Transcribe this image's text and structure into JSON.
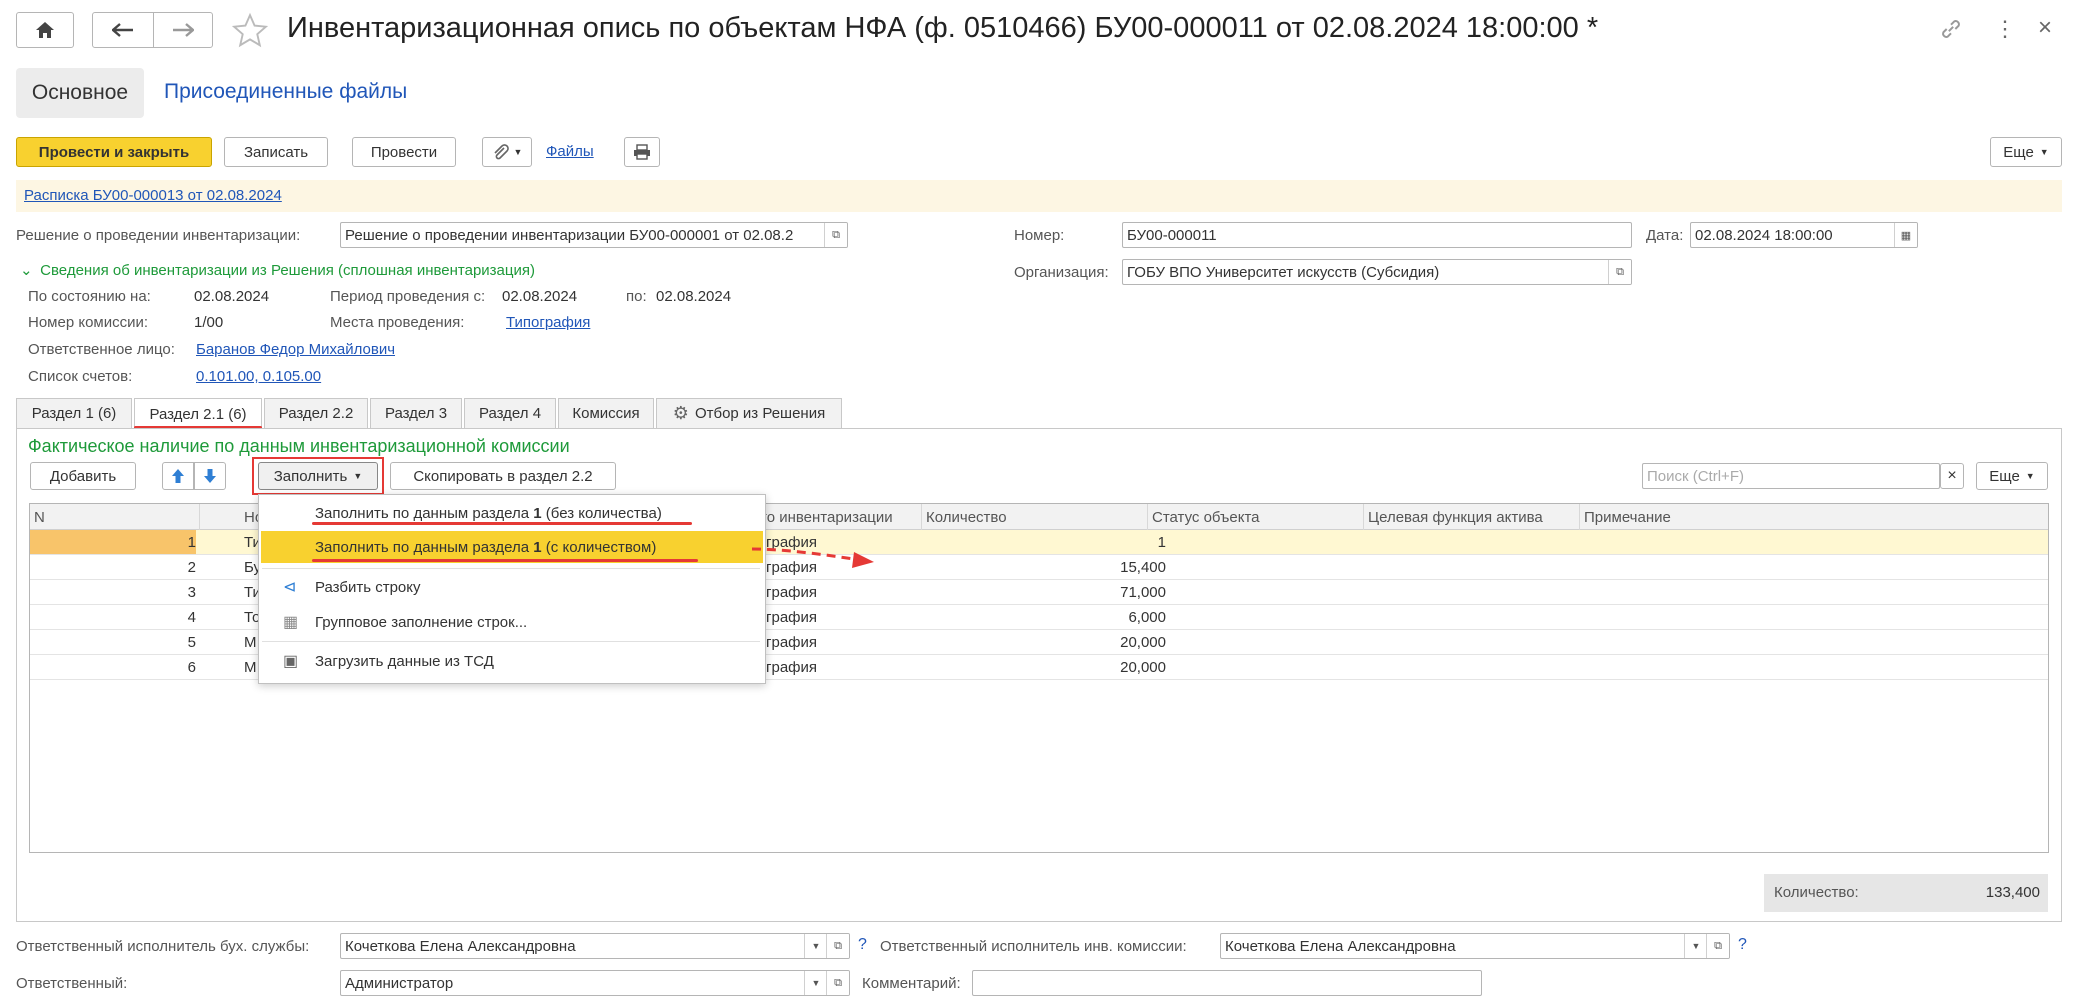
{
  "window": {
    "title": "Инвентаризационная опись по объектам НФА (ф. 0510466) БУ00-000011 от 02.08.2024 18:00:00 *"
  },
  "top_tabs": {
    "main": "Основное",
    "files": "Присоединенные файлы"
  },
  "toolbar": {
    "post_close": "Провести и закрыть",
    "save": "Записать",
    "post": "Провести",
    "files_link": "Файлы",
    "more": "Еще"
  },
  "receipt_link": "Расписка БУ00-000013 от 02.08.2024",
  "header": {
    "decision_label": "Решение о проведении инвентаризации:",
    "decision_value": "Решение о проведении инвентаризации БУ00-000001 от 02.08.2",
    "number_label": "Номер:",
    "number_value": "БУ00-000011",
    "date_label": "Дата:",
    "date_value": "02.08.2024 18:00:00",
    "org_label": "Организация:",
    "org_value": "ГОБУ ВПО Университет искусств (Субсидия)"
  },
  "decision_info": {
    "toggle": "Сведения об инвентаризации из Решения (сплошная инвентаризация)",
    "as_of_label": "По состоянию на:",
    "as_of_value": "02.08.2024",
    "period_label": "Период проведения с:",
    "period_from": "02.08.2024",
    "period_to_label": "по:",
    "period_to": "02.08.2024",
    "commission_label": "Номер комиссии:",
    "commission_value": "1/00",
    "place_label": "Места проведения:",
    "place_value": "Типография",
    "responsible_label": "Ответственное лицо:",
    "responsible_value": "Баранов Федор Михайлович",
    "accounts_label": "Список счетов:",
    "accounts_value": "0.101.00, 0.105.00"
  },
  "section_tabs": [
    "Раздел 1 (6)",
    "Раздел 2.1 (6)",
    "Раздел 2.2",
    "Раздел 3",
    "Раздел 4",
    "Комиссия",
    "Отбор из Решения"
  ],
  "panel": {
    "heading": "Фактическое наличие по данным инвентаризационной комиссии",
    "add": "Добавить",
    "fill": "Заполнить",
    "copy": "Скопировать в раздел 2.2",
    "search_placeholder": "Поиск (Ctrl+F)",
    "more": "Еще"
  },
  "table": {
    "columns": [
      "N",
      "Но",
      "то инвентаризации",
      "Количество",
      "Статус объекта",
      "Целевая функция актива",
      "Примечание"
    ],
    "rows": [
      {
        "n": "1",
        "name": "Ти",
        "place": "графия",
        "qty": "1"
      },
      {
        "n": "2",
        "name": "Бу",
        "place": "графия",
        "qty": "15,400"
      },
      {
        "n": "3",
        "name": "Ти",
        "place": "графия",
        "qty": "71,000"
      },
      {
        "n": "4",
        "name": "То",
        "place": "графия",
        "qty": "6,000"
      },
      {
        "n": "5",
        "name": "М",
        "place": "графия",
        "qty": "20,000"
      },
      {
        "n": "6",
        "name": "М",
        "place": "графия",
        "qty": "20,000"
      }
    ]
  },
  "dropdown": {
    "item1_pre": "Заполнить по данным раздела ",
    "item1_bold": "1",
    "item1_post": " (без количества)",
    "item2_pre": "Заполнить по данным раздела ",
    "item2_bold": "1",
    "item2_post": " (с количеством)",
    "item3": "Разбить строку",
    "item4": "Групповое заполнение строк...",
    "item5": "Загрузить данные из ТСД"
  },
  "total": {
    "label": "Количество:",
    "value": "133,400"
  },
  "footer": {
    "acc_exec_label": "Ответственный исполнитель бух. службы:",
    "acc_exec_value": "Кочеткова Елена Александровна",
    "comm_exec_label": "Ответственный исполнитель инв. комиссии:",
    "comm_exec_value": "Кочеткова Елена Александровна",
    "responsible_label": "Ответственный:",
    "responsible_value": "Администратор",
    "comment_label": "Комментарий:",
    "help": "?"
  },
  "colors": {
    "accent_yellow": "#f8d12f",
    "row_highlight": "#fff8d2",
    "green": "#1e9a3a",
    "link": "#2056b8",
    "red": "#e53935"
  }
}
